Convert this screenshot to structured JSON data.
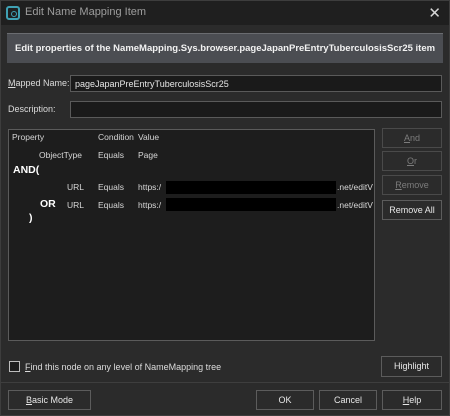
{
  "window": {
    "title": "Edit Name Mapping Item",
    "close_glyph": "✕"
  },
  "banner": {
    "text": "Edit properties of the NameMapping.Sys.browser.pageJapanPreEntryTuberculosisScr25 item"
  },
  "mapped_name": {
    "label_accel": "M",
    "label_rest": "apped Name:",
    "value": "pageJapanPreEntryTuberculosisScr25"
  },
  "description": {
    "label": "Description:",
    "value": ""
  },
  "table": {
    "headers": {
      "property": "Property",
      "condition": "Condition",
      "value": "Value"
    },
    "row_object": {
      "property": "ObjectType",
      "condition": "Equals",
      "value": "Page"
    },
    "and_open": "AND(",
    "row_url1": {
      "property": "URL",
      "condition": "Equals",
      "value_prefix": "https:/",
      "value_suffix": ".net/editV"
    },
    "or_label": "OR",
    "row_url2": {
      "property": "URL",
      "condition": "Equals",
      "value_prefix": "https:/",
      "value_suffix": ".net/editV"
    },
    "close_paren": ")"
  },
  "buttons": {
    "and": {
      "accel": "A",
      "rest": "nd"
    },
    "or": {
      "accel": "O",
      "rest": "r"
    },
    "remove": {
      "accel": "R",
      "rest": "emove"
    },
    "remove_all": "Remove All",
    "highlight": "Highlight",
    "basic_mode": {
      "accel": "B",
      "rest": "asic Mode"
    },
    "ok": "OK",
    "cancel": "Cancel",
    "help": {
      "accel": "H",
      "rest": "elp"
    }
  },
  "find_option": {
    "accel": "F",
    "rest": "ind this node on any level of NameMapping tree",
    "checked": false
  },
  "colors": {
    "accent_icon": "#3fa1b4",
    "banner_bg": "#4b4d52",
    "window_bg": "#2b2b2b"
  }
}
